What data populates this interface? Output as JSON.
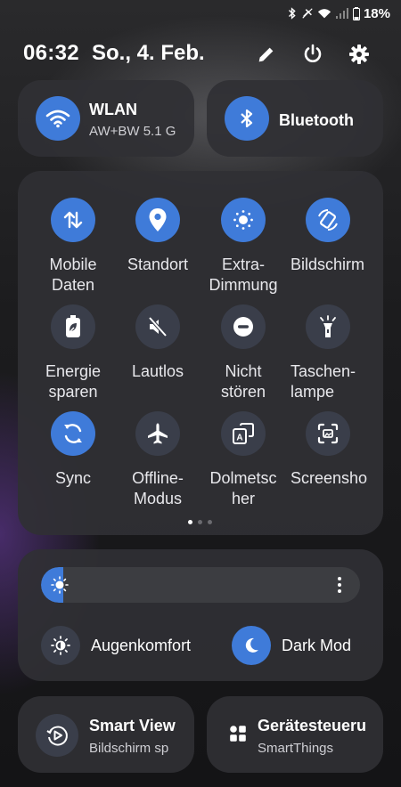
{
  "status_bar": {
    "battery": "18%"
  },
  "header": {
    "time": "06:32",
    "date": "So., 4. Feb."
  },
  "top_tiles": [
    {
      "title": "WLAN",
      "subtitle": "AW+BW 5.1 G"
    },
    {
      "title": "Bluetooth"
    }
  ],
  "quick_settings": [
    {
      "label": "Mobile\nDaten",
      "icon": "mobile-data-icon",
      "active": true
    },
    {
      "label": "Standort",
      "icon": "location-icon",
      "active": true
    },
    {
      "label": "Extra-\nDimmung",
      "icon": "extra-dim-icon",
      "active": true
    },
    {
      "label": "Bildschirm",
      "icon": "auto-rotate-icon",
      "active": true
    },
    {
      "label": "Energie\nsparen",
      "icon": "battery-saver-icon",
      "active": false
    },
    {
      "label": "Lautlos",
      "icon": "mute-icon",
      "active": false
    },
    {
      "label": "Nicht\nstören",
      "icon": "do-not-disturb-icon",
      "active": false
    },
    {
      "label": "Taschen-\nlampe",
      "icon": "flashlight-icon",
      "active": false
    },
    {
      "label": "Sync",
      "icon": "sync-icon",
      "active": true
    },
    {
      "label": "Offline-\nModus",
      "icon": "airplane-icon",
      "active": false
    },
    {
      "label": "Dolmetsc\nher",
      "icon": "interpreter-icon",
      "active": false
    },
    {
      "label": "Screensho",
      "icon": "screenshot-icon",
      "active": false
    }
  ],
  "pager": {
    "current_page": 1,
    "page_count": 3
  },
  "brightness": {
    "level": 0.07
  },
  "toggles": [
    {
      "label": "Augenkomfort",
      "icon": "eye-comfort-icon",
      "active": false
    },
    {
      "label": "Dark Mod",
      "icon": "dark-mode-icon",
      "active": true
    }
  ],
  "bottom_tiles": [
    {
      "title": "Smart View",
      "subtitle": "Bildschirm sp"
    },
    {
      "title": "Gerätesteueru",
      "subtitle": "SmartThings"
    }
  ],
  "colors": {
    "accent": "#3f7bd9",
    "inactive": "#3a3e4a",
    "panel": "#303034"
  }
}
